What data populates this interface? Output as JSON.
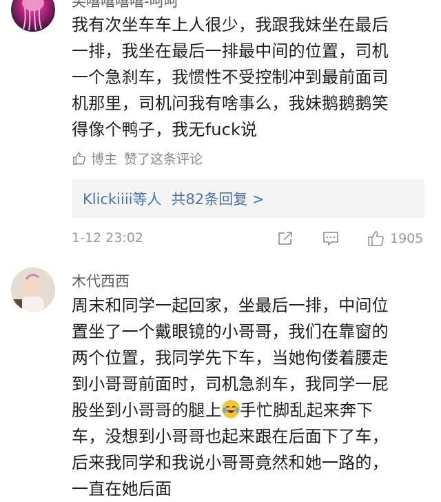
{
  "comment1": {
    "username": "笑嘻嘻嘻嘻-呵呵",
    "text": "我有次坐车车上人很少，我跟我妹坐在最后\n一排，我坐在最后一排最中间的位置，司机\n一个急刹车，我惯性不受控制冲到最前面司\n机那里，司机问我有啥事么，我妹鹅鹅鹅笑\n得像个鸭子，我无fuck说",
    "liked_by_author_role": "博主",
    "liked_by_author_text": "赞了这条评论",
    "reply_users": "Klickiiii等人",
    "reply_count_text": "共82条回复 >",
    "timestamp": "1-12 23:02",
    "like_count": "1905"
  },
  "comment2": {
    "username": "木代西西",
    "text_part1": "周末和同学一起回家，坐最后一排，中间位\n置坐了一个戴眼镜的小哥哥，我们在靠窗的\n两个位置，我同学先下车，当她佝偻着腰走\n到小哥哥前面时，司机急刹车，我同学一屁\n股坐到小哥哥的腿上",
    "text_part2": "手忙脚乱起来奔下\n车，没想到小哥哥也起来跟在后面下了车，\n后来我同学和我说小哥哥竟然和她一路的，\n一直在她后面",
    "emoji": "laughing-crying-emoji"
  }
}
